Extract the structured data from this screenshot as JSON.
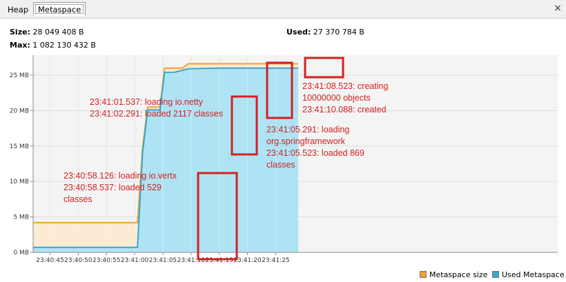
{
  "tabs": [
    {
      "label": "Heap",
      "active": false
    },
    {
      "label": "Metaspace",
      "active": true
    }
  ],
  "close_glyph": "×",
  "info": {
    "size_label": "Size:",
    "size_value": "28 049 408 B",
    "max_label": "Max:",
    "max_value": "1 082 130 432 B",
    "used_label": "Used:",
    "used_value": "27 370 784 B"
  },
  "legend": [
    {
      "label": "Metaspace size",
      "color": "#f0a030"
    },
    {
      "label": "Used Metaspace",
      "color": "#38a8c8"
    }
  ],
  "annotations": [
    {
      "lines": [
        "23:40:58.126: loading io.vertx",
        "23:40:58.537: loaded 529",
        "classes"
      ],
      "color": "#d42020"
    },
    {
      "lines": [
        "23:41:01.537: loading io.netty",
        "23:41:02.291: loaded 2117 classes"
      ],
      "color": "#d42020"
    },
    {
      "lines": [
        "23:41:05.291: loading",
        "org.springframework",
        "23:41:05.523: loaded 869",
        "classes"
      ],
      "color": "#d42020"
    },
    {
      "lines": [
        "23:41:08.523: creating",
        "10000000 objects",
        "23:41:10.088: created"
      ],
      "color": "#d42020"
    }
  ],
  "chart_data": {
    "type": "area",
    "x_unit": "time",
    "y_unit": "MB",
    "x_ticks": [
      "23:40:45",
      "23:40:50",
      "23:40:55",
      "23:41:00",
      "23:41:05",
      "23:41:10",
      "23:41:15",
      "23:41:20",
      "23:41:25"
    ],
    "y_ticks": [
      "0 MB",
      "5 MB",
      "10 MB",
      "15 MB",
      "20 MB",
      "25 MB"
    ],
    "ylim": [
      0,
      27
    ],
    "grid": true,
    "legend_position": "bottom-right",
    "series": [
      {
        "name": "Metaspace size",
        "color": "#f0a030",
        "fill": "#fde9d0",
        "points": [
          [
            "23:40:42",
            4.2
          ],
          [
            "23:41:00.5",
            4.2
          ],
          [
            "23:41:01.4",
            14.8
          ],
          [
            "23:41:02.3",
            20.5
          ],
          [
            "23:41:04.5",
            20.5
          ],
          [
            "23:41:05.3",
            26.0
          ],
          [
            "23:41:08.5",
            26.0
          ],
          [
            "23:41:09.5",
            26.6
          ],
          [
            "23:41:29",
            26.6
          ]
        ]
      },
      {
        "name": "Used Metaspace",
        "color": "#38a8c8",
        "fill": "#aee3f4",
        "points": [
          [
            "23:40:42",
            0.7
          ],
          [
            "23:41:00.5",
            0.7
          ],
          [
            "23:41:01.4",
            14.0
          ],
          [
            "23:41:02.3",
            20.1
          ],
          [
            "23:41:04.5",
            20.1
          ],
          [
            "23:41:05.3",
            25.4
          ],
          [
            "23:41:07.0",
            25.4
          ],
          [
            "23:41:09.5",
            25.9
          ],
          [
            "23:41:15",
            26.0
          ],
          [
            "23:41:29",
            26.0
          ]
        ]
      }
    ]
  }
}
